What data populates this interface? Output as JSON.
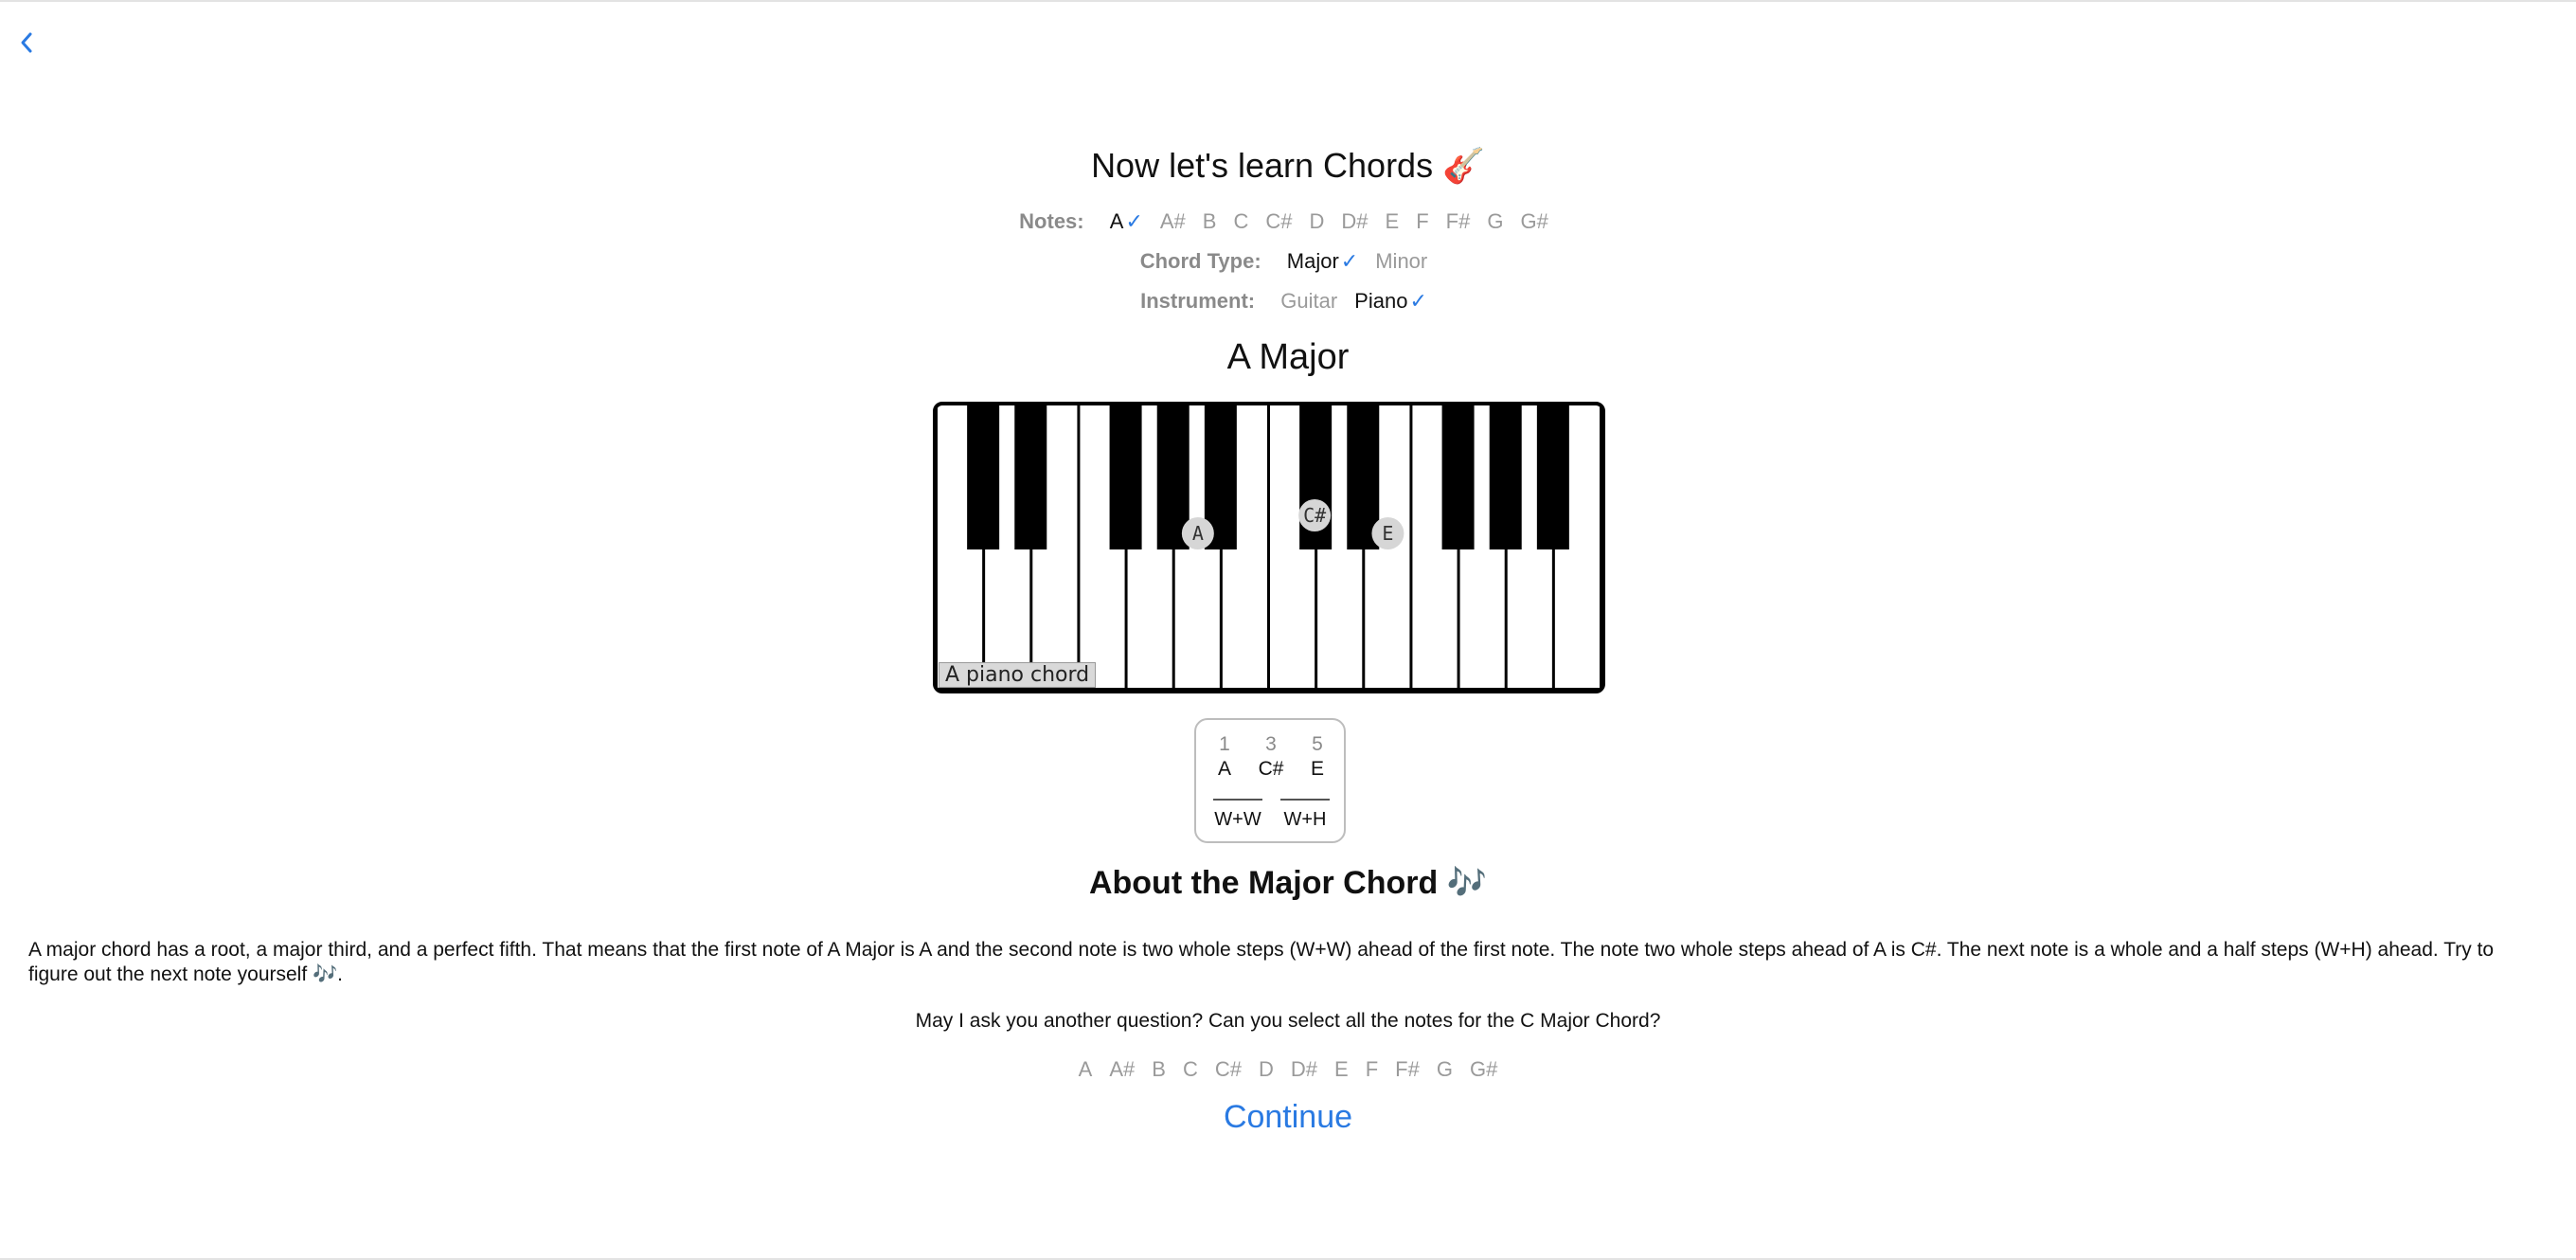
{
  "title": "Now let's learn Chords 🎸",
  "notes_row": {
    "label": "Notes:",
    "options": [
      {
        "label": "A",
        "selected": true
      },
      {
        "label": "A#",
        "selected": false
      },
      {
        "label": "B",
        "selected": false
      },
      {
        "label": "C",
        "selected": false
      },
      {
        "label": "C#",
        "selected": false
      },
      {
        "label": "D",
        "selected": false
      },
      {
        "label": "D#",
        "selected": false
      },
      {
        "label": "E",
        "selected": false
      },
      {
        "label": "F",
        "selected": false
      },
      {
        "label": "F#",
        "selected": false
      },
      {
        "label": "G",
        "selected": false
      },
      {
        "label": "G#",
        "selected": false
      }
    ]
  },
  "chord_type_row": {
    "label": "Chord Type:",
    "options": [
      {
        "label": "Major",
        "selected": true
      },
      {
        "label": "Minor",
        "selected": false
      }
    ]
  },
  "instrument_row": {
    "label": "Instrument:",
    "options": [
      {
        "label": "Guitar",
        "selected": false
      },
      {
        "label": "Piano",
        "selected": true
      }
    ]
  },
  "check_mark": "✓",
  "chord_name": "A Major",
  "piano": {
    "caption": "A piano chord",
    "markers": {
      "c_sharp": "C#",
      "a": "A",
      "e": "E"
    }
  },
  "intervals": {
    "degrees": [
      "1",
      "3",
      "5"
    ],
    "notes": [
      "A",
      "C#",
      "E"
    ],
    "steps": [
      "W+W",
      "W+H"
    ]
  },
  "about_title": "About the Major Chord 🎶",
  "about_text": "A major chord has a root, a major third, and a perfect fifth. That means that the first note of A Major is A and the second note is two whole steps (W+W) ahead of the first note. The note two whole steps ahead of A is C#. The next note is a whole and a half steps (W+H) ahead. Try to figure out the next note yourself 🎶.",
  "question": "May I ask you another question? Can you select all the notes for the C Major Chord?",
  "answer_options": [
    "A",
    "A#",
    "B",
    "C",
    "C#",
    "D",
    "D#",
    "E",
    "F",
    "F#",
    "G",
    "G#"
  ],
  "continue_label": "Continue",
  "colors": {
    "accent": "#2a7ae2",
    "muted": "#9a9a9a",
    "marker": "#d6d6d6"
  }
}
